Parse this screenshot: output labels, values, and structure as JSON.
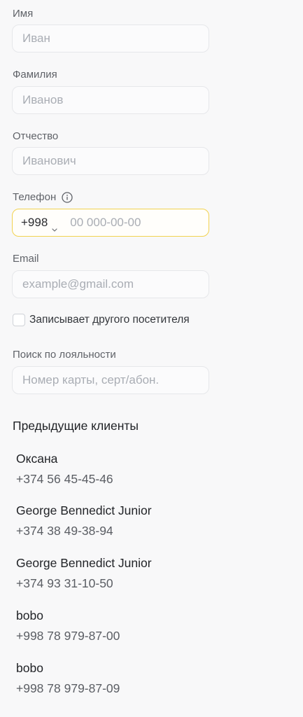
{
  "form": {
    "first_name": {
      "label": "Имя",
      "placeholder": "Иван"
    },
    "last_name": {
      "label": "Фамилия",
      "placeholder": "Иванов"
    },
    "patronymic": {
      "label": "Отчество",
      "placeholder": "Иванович"
    },
    "phone": {
      "label": "Телефон",
      "code": "+998",
      "placeholder": "00 000-00-00"
    },
    "email": {
      "label": "Email",
      "placeholder": "example@gmail.com"
    },
    "checkbox_label": "Записывает другого посетителя",
    "loyalty": {
      "label": "Поиск по лояльности",
      "placeholder": "Номер карты, серт/абон."
    }
  },
  "previous_clients": {
    "title": "Предыдущие клиенты",
    "items": [
      {
        "name": "Оксана",
        "phone": "+374 56 45-45-46"
      },
      {
        "name": "George Bennedict Junior",
        "phone": "+374 38 49-38-94"
      },
      {
        "name": "George Bennedict Junior",
        "phone": "+374 93 31-10-50"
      },
      {
        "name": "bobo",
        "phone": "+998 78 979-87-00"
      },
      {
        "name": "bobo",
        "phone": "+998 78 979-87-09"
      }
    ]
  },
  "colors": {
    "focus_border": "#f2d24f",
    "input_border": "#e6e7ea",
    "placeholder": "#a9adb4"
  }
}
